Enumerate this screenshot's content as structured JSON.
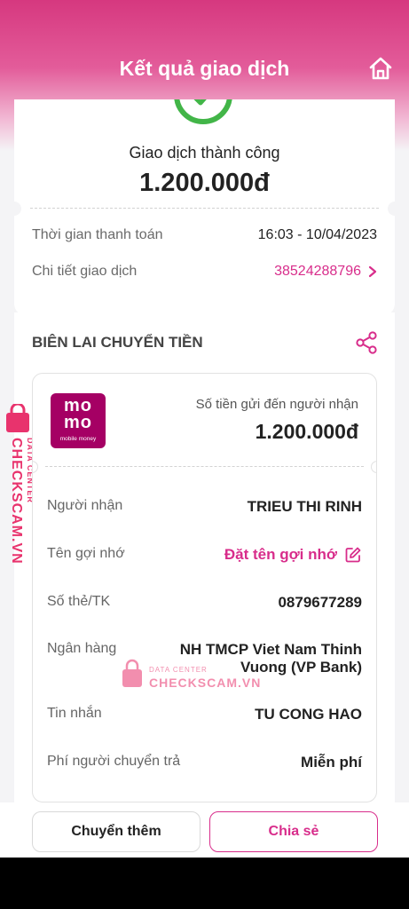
{
  "header": {
    "title": "Kết quả giao dịch"
  },
  "result": {
    "status": "Giao dịch thành công",
    "amount": "1.200.000đ",
    "payment_time_label": "Thời gian thanh toán",
    "payment_time_value": "16:03 - 10/04/2023",
    "detail_label": "Chi tiết giao dịch",
    "detail_value": "38524288796"
  },
  "receipt": {
    "title": "BIÊN LAI CHUYỂN TIỀN",
    "logo": {
      "line1": "mo",
      "line2": "mo",
      "line3": "mobile money"
    },
    "received_label": "Số tiền gửi đến người nhận",
    "received_amount": "1.200.000đ",
    "rows": {
      "recipient_label": "Người nhận",
      "recipient_value": "TRIEU THI RINH",
      "nickname_label": "Tên gợi nhớ",
      "nickname_value": "Đặt tên gợi nhớ",
      "account_label": "Số thẻ/TK",
      "account_value": "0879677289",
      "bank_label": "Ngân hàng",
      "bank_value_line1": "NH TMCP Viet Nam Thinh",
      "bank_value_line2": "Vuong (VP Bank)",
      "message_label": "Tin nhắn",
      "message_value": "TU CONG HAO",
      "fee_label": "Phí người chuyển trả",
      "fee_value": "Miễn phí"
    }
  },
  "buttons": {
    "more": "Chuyển thêm",
    "share": "Chia sẻ"
  },
  "watermark": {
    "text1": "DATA CENTER",
    "text2": "CHECKSCAM.VN"
  },
  "colors": {
    "brand_pink": "#d82d8b",
    "momo": "#a50064",
    "success_green": "#42b548"
  },
  "icons": [
    "home-icon",
    "check-icon",
    "chevron-right-icon",
    "share-icon",
    "edit-icon",
    "lock-icon"
  ]
}
